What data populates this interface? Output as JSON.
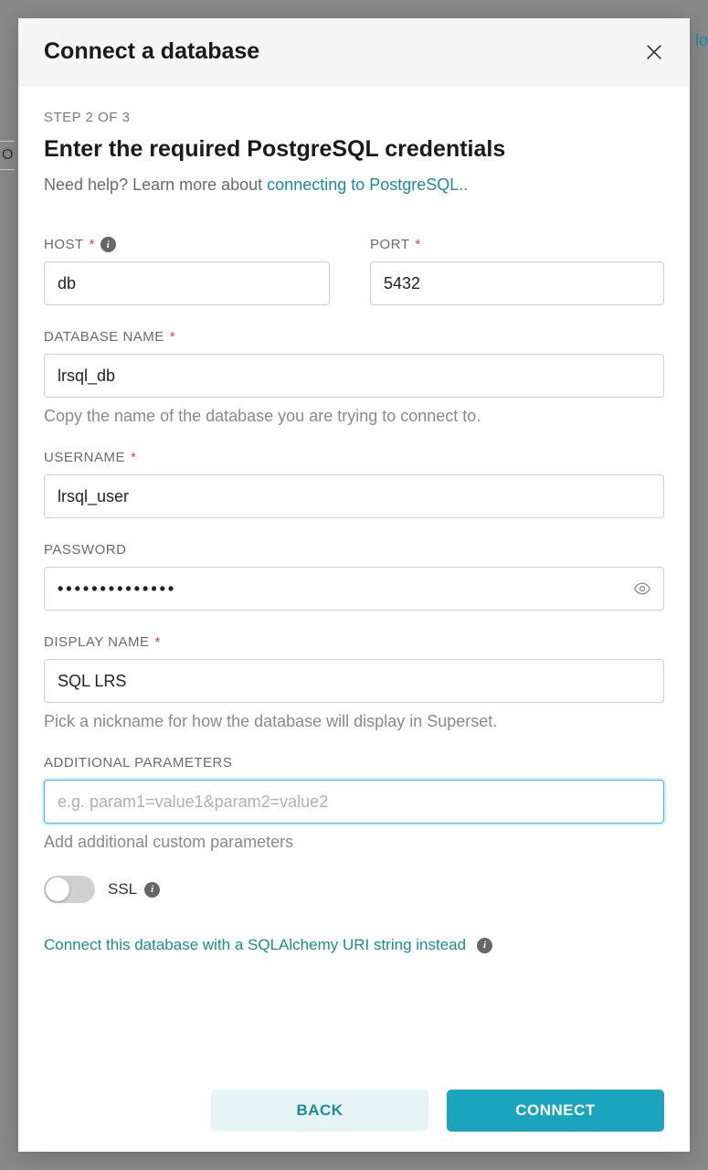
{
  "background_fragments": {
    "right": "lo",
    "left": "O"
  },
  "modal": {
    "title": "Connect a database",
    "step": "STEP 2 OF 3",
    "heading": "Enter the required PostgreSQL credentials",
    "help_prefix": "Need help? Learn more about ",
    "help_link": "connecting to PostgreSQL..",
    "fields": {
      "host": {
        "label": "HOST",
        "value": "db"
      },
      "port": {
        "label": "PORT",
        "value": "5432"
      },
      "database_name": {
        "label": "DATABASE NAME",
        "value": "lrsql_db",
        "helper": "Copy the name of the database you are trying to connect to."
      },
      "username": {
        "label": "USERNAME",
        "value": "lrsql_user"
      },
      "password": {
        "label": "PASSWORD",
        "value": "••••••••••••••"
      },
      "display_name": {
        "label": "DISPLAY NAME",
        "value": "SQL LRS",
        "helper": "Pick a nickname for how the database will display in Superset."
      },
      "additional_parameters": {
        "label": "ADDITIONAL PARAMETERS",
        "placeholder": "e.g. param1=value1&param2=value2",
        "helper": "Add additional custom parameters"
      },
      "ssl": {
        "label": "SSL"
      }
    },
    "alt_link": "Connect this database with a SQLAlchemy URI string instead",
    "buttons": {
      "back": "BACK",
      "connect": "CONNECT"
    }
  }
}
